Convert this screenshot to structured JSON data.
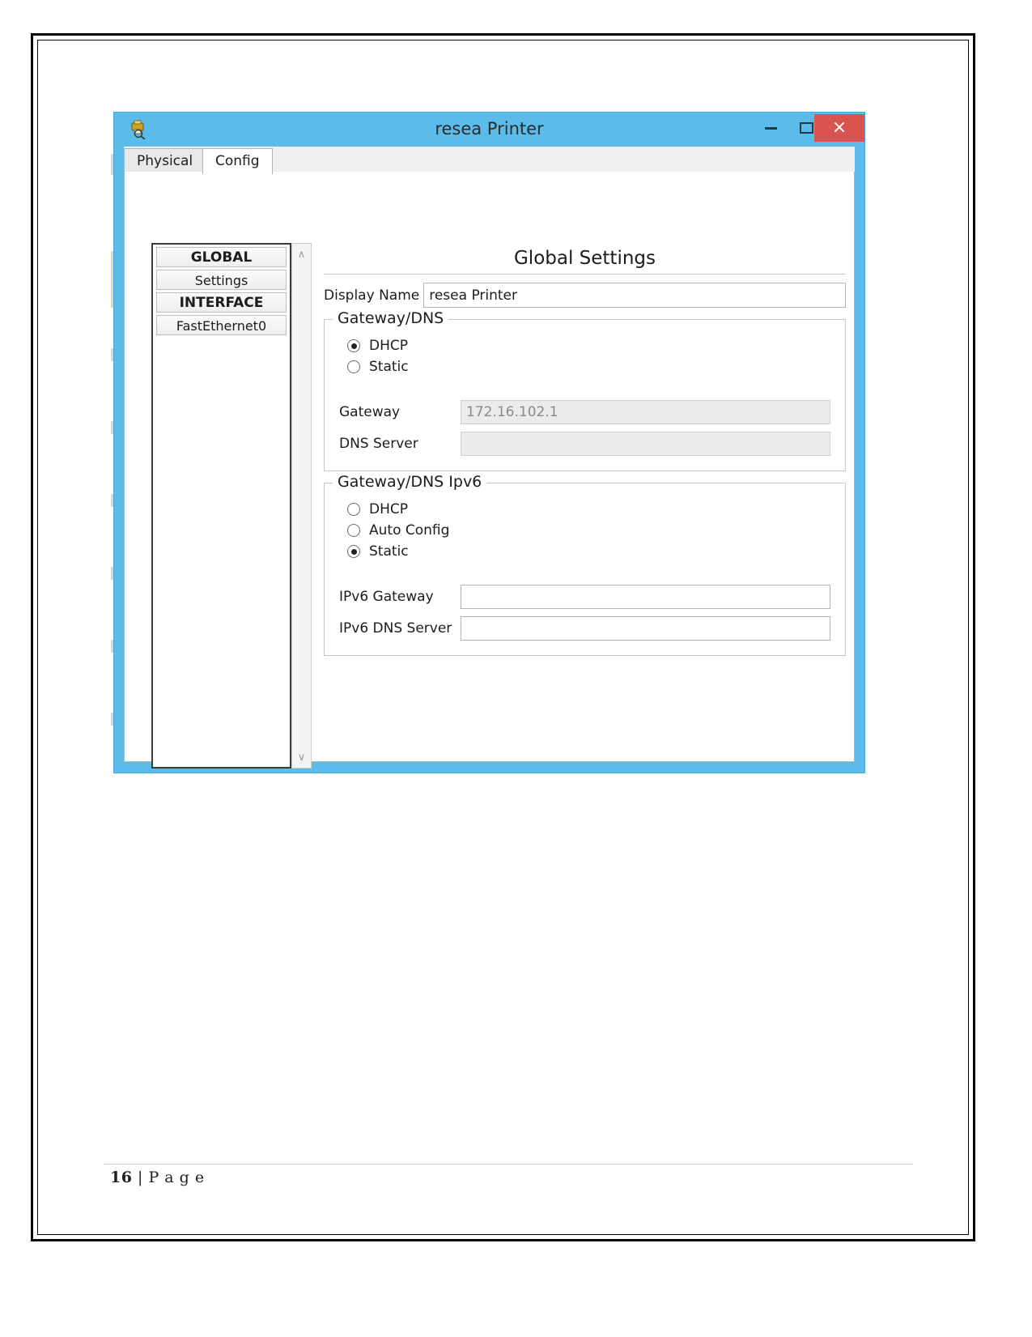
{
  "window": {
    "title": "resea Printer",
    "icon": "printer-icon",
    "controls": {
      "minimize": "–",
      "maximize": "□",
      "close": "×"
    }
  },
  "tabs": [
    {
      "label": "Physical",
      "active": false
    },
    {
      "label": "Config",
      "active": true
    }
  ],
  "tree": {
    "items": [
      {
        "label": "GLOBAL",
        "header": true
      },
      {
        "label": "Settings",
        "header": false
      },
      {
        "label": "INTERFACE",
        "header": true
      },
      {
        "label": "FastEthernet0",
        "header": false
      }
    ],
    "scroll_up": "∧",
    "scroll_down": "∨"
  },
  "settings": {
    "title": "Global Settings",
    "display_name": {
      "label": "Display Name",
      "value": "resea Printer",
      "placeholder": ""
    },
    "gateway_dns": {
      "legend": "Gateway/DNS",
      "options": [
        {
          "label": "DHCP",
          "selected": true
        },
        {
          "label": "Static",
          "selected": false
        }
      ],
      "fields": [
        {
          "label": "Gateway",
          "value": "172.16.102.1",
          "disabled": true
        },
        {
          "label": "DNS Server",
          "value": "",
          "disabled": true
        }
      ]
    },
    "gateway_dns_ipv6": {
      "legend": "Gateway/DNS Ipv6",
      "options": [
        {
          "label": "DHCP",
          "selected": false
        },
        {
          "label": "Auto Config",
          "selected": false
        },
        {
          "label": "Static",
          "selected": true
        }
      ],
      "fields": [
        {
          "label": "IPv6 Gateway",
          "value": "",
          "disabled": false
        },
        {
          "label": "IPv6 DNS Server",
          "value": "",
          "disabled": false
        }
      ]
    }
  },
  "footer": {
    "page_number": "16",
    "separator": "|",
    "page_word": "P a g e"
  },
  "colors": {
    "titlebar": "#5bbcea",
    "close_button": "#d9534f",
    "disabled_field": "#ebebeb"
  }
}
